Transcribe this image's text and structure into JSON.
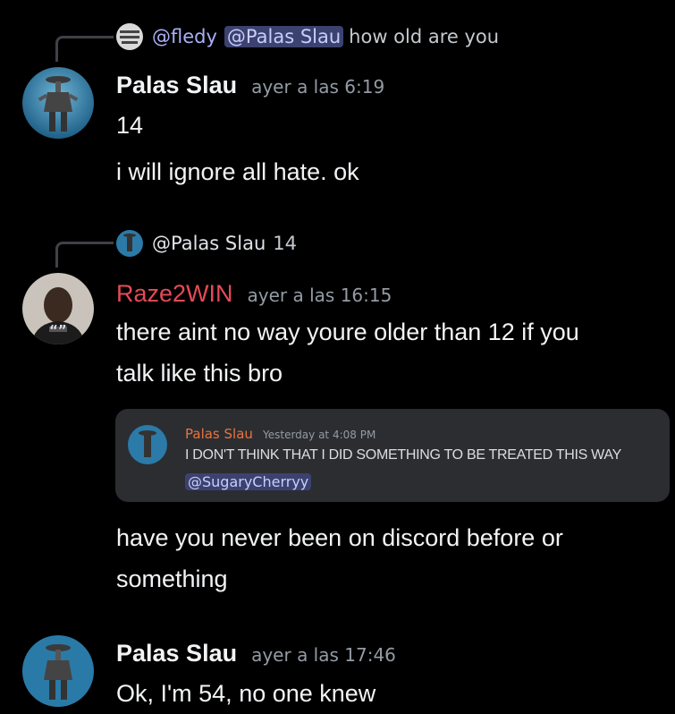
{
  "messages": [
    {
      "reply": {
        "author": "@fledy",
        "mention": "@Palas Slau",
        "text": "how old are you"
      },
      "author": "Palas Slau",
      "timestamp": "ayer a las 6:19",
      "lines": [
        "14",
        "i will ignore all hate. ok"
      ]
    },
    {
      "reply": {
        "author": "@Palas Slau",
        "text": "14"
      },
      "author": "Raze2WIN",
      "timestamp": "ayer a las 16:15",
      "badge": "“”",
      "lines": [
        "there aint no way youre older than 12 if you",
        "talk like this bro"
      ],
      "embed": {
        "author": "Palas Slau",
        "timestamp": "Yesterday at 4:08 PM",
        "text": "I DON'T THINK THAT I DID SOMETHING TO BE TREATED THIS WAY",
        "mention": "@SugaryCherryy"
      },
      "after_lines": [
        "have you never been on discord before or",
        "something"
      ]
    },
    {
      "author": "Palas Slau",
      "timestamp": "ayer a las 17:46",
      "lines": [
        "Ok, I'm 54, no one knew"
      ]
    }
  ],
  "colors": {
    "background": "#000000",
    "mention_bg": "#3c4270",
    "raze_name": "#e54a57",
    "embed_author": "#e8743f"
  }
}
